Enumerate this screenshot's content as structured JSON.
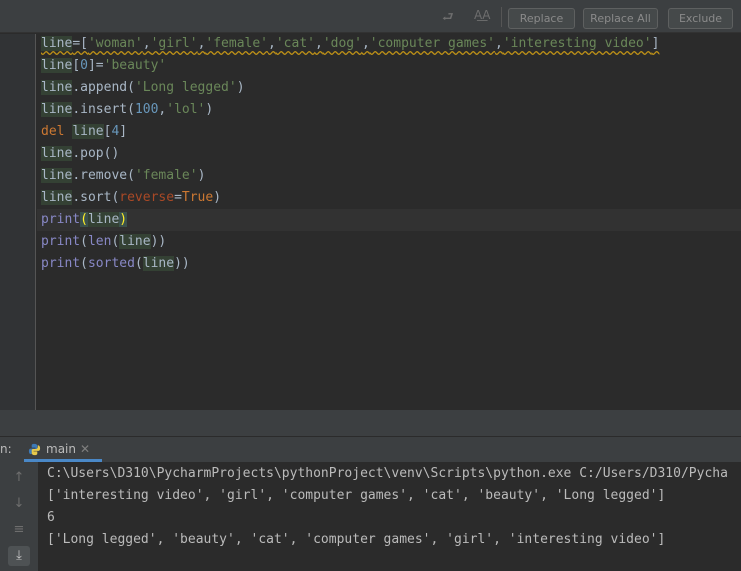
{
  "toolbar": {
    "replace_label": "Replace",
    "replace_all_label": "Replace All",
    "exclude_label": "Exclude",
    "regex_toggle_icon": "preserve-case-icon",
    "undo_icon": "undo-arrow-icon"
  },
  "code": {
    "lines": [
      "line=['woman','girl','female','cat','dog','computer games','interesting video']",
      "line[0]='beauty'",
      "line.append('Long legged')",
      "line.insert(100,'lol')",
      "del line[4]",
      "line.pop()",
      "line.remove('female')",
      "line.sort(reverse=True)",
      "print(line)",
      "print(len(line))",
      "print(sorted(line))"
    ]
  },
  "run": {
    "panel_label": "n:",
    "tab_label": "main",
    "tab_icon": "python-file-icon",
    "close_icon": "close-icon"
  },
  "console": {
    "lines": [
      "C:\\Users\\D310\\PycharmProjects\\pythonProject\\venv\\Scripts\\python.exe C:/Users/D310/Pycha",
      "['interesting video', 'girl', 'computer games', 'cat', 'beauty', 'Long legged']",
      "6",
      "['Long legged', 'beauty', 'cat', 'computer games', 'girl', 'interesting video']"
    ]
  },
  "colors": {
    "editor_bg": "#2b2b2b",
    "string": "#6a8759",
    "number": "#6897bb",
    "keyword": "#cc7832",
    "builtin": "#8888c6",
    "tab_accent": "#4a88c7"
  }
}
